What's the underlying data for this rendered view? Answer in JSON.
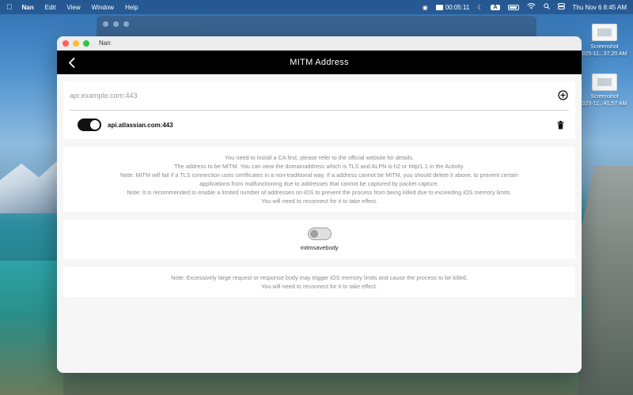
{
  "menubar": {
    "app_name": "Nan",
    "menus": [
      "Edit",
      "View",
      "Window",
      "Help"
    ],
    "timer": "00:05:11",
    "input_badge": "A",
    "datetime": "Thu Nov 6  8:45 AM"
  },
  "desktop": {
    "icons": [
      {
        "line1": "Screenshot",
        "line2": "025-11...37.20 AM"
      },
      {
        "line1": "Screenshot",
        "line2": "025-11...41.57 AM"
      }
    ]
  },
  "window": {
    "title": "Nan",
    "nav_title": "MITM Address",
    "input": {
      "placeholder": "api.example.com:443",
      "value": ""
    },
    "address": {
      "label": "api.atlassian.com:443",
      "enabled": true
    },
    "info_lines": [
      "You need to install a CA first, please refer to the official website for details.",
      "The address to be MITM. You can view the domainaddress which is TLS and ALPN is h2 or http/1.1 in the Activity.",
      "Note: MITM will fail if a TLS connection uses certificates in a non-traditional way. If a address cannot be MITM, you should delete it above, to prevent certain",
      "applications from malfunctioning due to addresses that cannot be captured by packet capture.",
      "Note: It is recommended to enable a limited number of addresses on iOS to prevent the process from being killed due to exceeding iOS memory limits.",
      "You will need to reconnect for it to take effect."
    ],
    "save_body": {
      "label": "mitmsavebody",
      "enabled": false
    },
    "note_lines": [
      "Note: Excessively large request or response body may trigger iOS memory limits and cause the process to be killed.",
      "You will need to reconnect for it to take effect."
    ]
  },
  "colors": {
    "nav_bg": "#000000",
    "toggle_on": "#111111",
    "muted_text": "#8a8a8a"
  }
}
